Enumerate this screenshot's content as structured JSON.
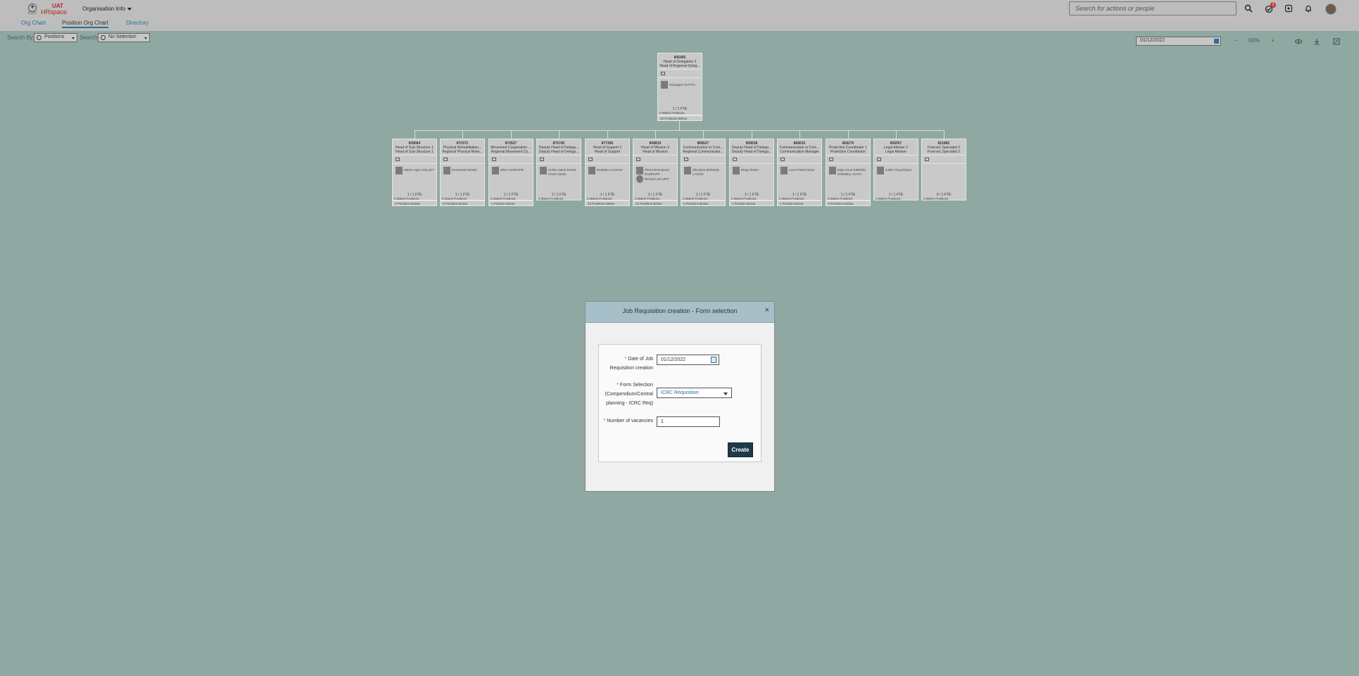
{
  "header": {
    "logo_uat": "UAT",
    "logo_hr": "HRspace",
    "logo_org": "ICRC",
    "org_menu": "Organisation Info",
    "search_placeholder": "Search for actions or people",
    "approvals_count": "2"
  },
  "tabs": [
    {
      "label": "Org Chart"
    },
    {
      "label": "Position Org Chart"
    },
    {
      "label": "Directory"
    }
  ],
  "toolbar": {
    "search_by_label": "Search By",
    "search_by_value": "Positions",
    "search_label": "Search",
    "search_value": "No Selection",
    "date": "01/12/2022",
    "zoom": "60%",
    "zoom_out": "−",
    "zoom_in": "+"
  },
  "root_card": {
    "code": "845456",
    "title1": "Head of Delegation 2",
    "title2": "Head of Regional Deleg...",
    "name": "Giuseppe GUTTAI",
    "fte": "1 / 1 FTE",
    "matrix": "0 Matrix Positions",
    "below": "20 Positions Below"
  },
  "children": [
    {
      "code": "838064",
      "t1": "Head of Sub-Structure 1",
      "t2": "Head of Sub-Structure 1",
      "name": "Martin Agus JOILLET",
      "fte": "1 / 1 FTE",
      "matrix": "0 Matrix Positions",
      "below": "2 Positions Below"
    },
    {
      "code": "870371",
      "t1": "Physical Rehabilitation...",
      "t2": "Regional Physical Reha...",
      "name": "Emmanuel MAMA",
      "fte": "1 / 1 FTE",
      "matrix": "0 Matrix Positions",
      "below": "6 Positions Below"
    },
    {
      "code": "870527",
      "t1": "Movement Cooperation ...",
      "t2": "Regional Movement Co...",
      "name": "Elies ASHRAFIE",
      "fte": "1 / 1 FTE",
      "matrix": "0 Matrix Positions",
      "below": "1 Position Below"
    },
    {
      "code": "876745",
      "t1": "Deputy Head of Delega...",
      "t2": "Deputy Head of Delega...",
      "name": "Celine Marie Ernest Green-Santo",
      "fte": "1 / 1 FTE",
      "matrix": "0 Matrix Positions",
      "below": ""
    },
    {
      "code": "877406",
      "t1": "Head of Support 2",
      "t2": "Head of Support",
      "name": "Roulabo LAUSAN",
      "fte": "1 / 1 FTE",
      "matrix": "0 Matrix Positions",
      "below": "10 Positions Below"
    },
    {
      "code": "858819",
      "t1": "Head of Mission 3",
      "t2": "Head of Mission",
      "name": "Pierre Emmanuel GUDRUFF",
      "name2": "Richard LELUPIT",
      "fte": "1 / 1 FTE",
      "matrix": "0 Matrix Positions",
      "below": "11 Positions Below"
    },
    {
      "code": "868527",
      "t1": "Communication or Com...",
      "t2": "Regional Communicatio...",
      "name": "Zhicdana BONSOL LAGOS",
      "fte": "1 / 1 FTE",
      "matrix": "0 Matrix Positions",
      "below": "2 Positions Below"
    },
    {
      "code": "858638",
      "t1": "Deputy Head of Delega...",
      "t2": "Deputy Head of Delega...",
      "name": "Diego BADA",
      "fte": "1 / 1 FTE",
      "matrix": "0 Matrix Positions",
      "below": "1 Position Below"
    },
    {
      "code": "868632",
      "t1": "Communication or Com...",
      "t2": "Communication Manager",
      "name": "Leon Patrick Boko",
      "fte": "1 / 1 FTE",
      "matrix": "0 Matrix Positions",
      "below": "1 Position Below"
    },
    {
      "code": "868270",
      "t1": "Protection Coordinator 1",
      "t2": "Protection Coordinator",
      "name": "Maja Anna SIMIORI ZHEMELL-NATS",
      "fte": "1 / 1 FTE",
      "matrix": "0 Matrix Positions",
      "below": "8 Positions Below"
    },
    {
      "code": "856057",
      "t1": "Legal Adviser 2",
      "t2": "Legal Adviser",
      "name": "Julien Chouchaoui",
      "fte": "1 / 1 FTE",
      "matrix": "0 Matrix Positions",
      "below": ""
    },
    {
      "code": "821882",
      "t1": "Forensic Specialist 2",
      "t2": "Forensic Specialist 2",
      "name": "",
      "fte": "0 / 1 FTE",
      "matrix": "0 Matrix Positions",
      "below": ""
    }
  ],
  "modal": {
    "title": "Job Requisition creation - Form selection",
    "close": "×",
    "required_mark": "*",
    "date_label": "Date of Job Requisition creation",
    "date_value": "01/12/2022",
    "form_label": "Form Selection (Compendium/Central planning - ICRC Req)",
    "form_value": "ICRC Requisition",
    "vacancies_label": "Number of vacancies",
    "vacancies_value": "1",
    "create": "Create"
  },
  "colors": {
    "background": "#8fa8a2",
    "shell": "#bdbdbd",
    "accent": "#2a6f94",
    "brand": "#b3261e",
    "create_button": "#1e3a49"
  }
}
